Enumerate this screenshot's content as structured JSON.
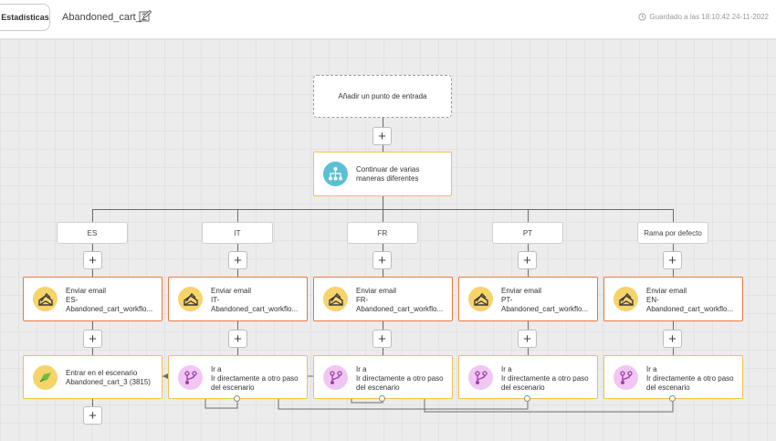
{
  "header": {
    "stats_label": "Estadísticas",
    "title": "Abandoned_cart_2",
    "saved_text": "Guardado a las 18:10:42 24-11-2022"
  },
  "entry": {
    "label": "Añadir un punto de entrada"
  },
  "split": {
    "label_line1": "Continuar de varias",
    "label_line2": "maneras diferentes"
  },
  "plus_symbol": "+",
  "branches": [
    {
      "label": "ES",
      "email_title": "Enviar email",
      "email_line2": "ES-",
      "email_line3": "Abandoned_cart_workflo...",
      "action_line1": "Entrar en el escenario",
      "action_line2": "Abandoned_cart_3 (3815)"
    },
    {
      "label": "IT",
      "email_title": "Enviar email",
      "email_line2": "IT-",
      "email_line3": "Abandoned_cart_workflo...",
      "action_line1": "Ir a",
      "action_line2": "Ir directamente a otro paso",
      "action_line3": "del escenario"
    },
    {
      "label": "FR",
      "email_title": "Enviar email",
      "email_line2": "FR-",
      "email_line3": "Abandoned_cart_workflo...",
      "action_line1": "Ir a",
      "action_line2": "Ir directamente a otro paso",
      "action_line3": "del escenario"
    },
    {
      "label": "PT",
      "email_title": "Enviar email",
      "email_line2": "PT-",
      "email_line3": "Abandoned_cart_workflo...",
      "action_line1": "Ir a",
      "action_line2": "Ir directamente a otro paso",
      "action_line3": "del escenario"
    },
    {
      "label": "Rama por defecto",
      "email_title": "Enviar email",
      "email_line2": "EN-",
      "email_line3": "Abandoned_cart_workflo...",
      "action_line1": "Ir a",
      "action_line2": "Ir directamente a otro paso",
      "action_line3": "del escenario"
    }
  ],
  "colors": {
    "node_yellow": "#f2c14a",
    "node_orange": "#e87a3e",
    "split_icon": "#5bc0d3",
    "email_icon": "#f7d36b",
    "goto_icon": "#f1c6f2",
    "enter_icon": "#f7d36b"
  },
  "icons": {
    "edit": "pencil-icon",
    "clock": "clock-icon",
    "split": "branch-split-icon",
    "email": "envelope-send-icon",
    "goto": "git-branch-icon",
    "enter": "scenario-enter-icon"
  }
}
